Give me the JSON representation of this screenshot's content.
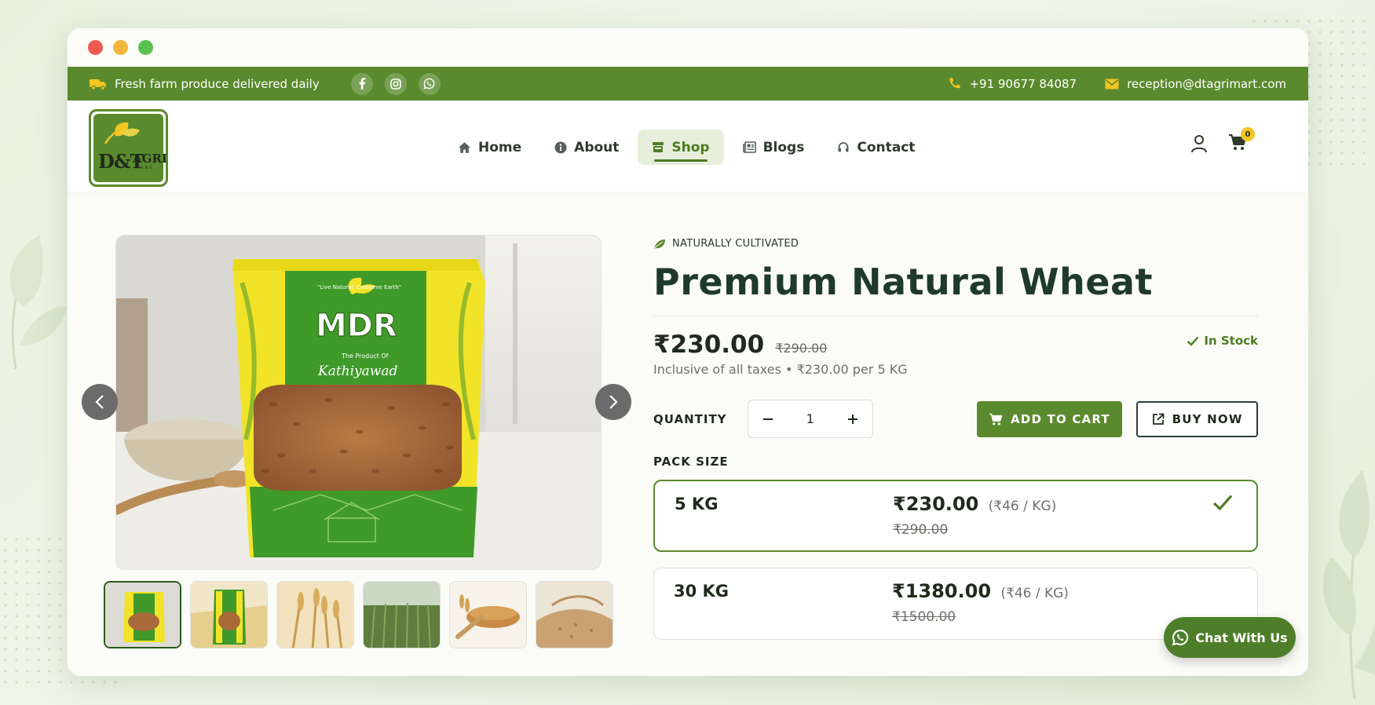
{
  "colors": {
    "brand_green": "#5a8a2d",
    "dark_green": "#1f3a2c",
    "badge_yellow": "#f3c623",
    "window_close": "#ee5a52",
    "window_minimize": "#f4b63b",
    "window_maximize": "#5bc052"
  },
  "topbar": {
    "delivery_text": "Fresh farm produce delivered daily",
    "social_icons": [
      "facebook-icon",
      "instagram-icon",
      "whatsapp-icon"
    ],
    "phone": "+91 90677 84087",
    "email": "reception@dtagrimart.com"
  },
  "logo": {
    "text_main": "D&T",
    "text_side": "AGRI",
    "text_small": "MART"
  },
  "nav": {
    "items": [
      {
        "label": "Home",
        "icon": "home-icon"
      },
      {
        "label": "About",
        "icon": "info-icon"
      },
      {
        "label": "Shop",
        "icon": "shop-icon",
        "active": true
      },
      {
        "label": "Blogs",
        "icon": "newspaper-icon"
      },
      {
        "label": "Contact",
        "icon": "headset-icon"
      }
    ],
    "cart_count": "0"
  },
  "product": {
    "tag": "NATURALLY CULTIVATED",
    "title": "Premium Natural Wheat",
    "price": "₹230.00",
    "old_price": "₹290.00",
    "stock": "In Stock",
    "tax_note": "Inclusive of all taxes • ₹230.00 per 5 KG",
    "quantity_label": "QUANTITY",
    "quantity": "1",
    "add_to_cart": "ADD TO CART",
    "buy_now": "BUY NOW",
    "pack_label": "PACK SIZE",
    "packs": [
      {
        "size": "5 KG",
        "price": "₹230.00",
        "per_unit": "(₹46 / KG)",
        "old_price": "₹290.00",
        "selected": true
      },
      {
        "size": "30 KG",
        "price": "₹1380.00",
        "per_unit": "(₹46 / KG)",
        "old_price": "₹1500.00",
        "selected": false
      }
    ]
  },
  "packaging": {
    "brand": "MDR",
    "tagline": "\"Live Natural, Consume Earth\"",
    "sub1": "The Product Of",
    "sub2": "Kathiyawad"
  },
  "chat": {
    "label": "Chat With Us"
  }
}
